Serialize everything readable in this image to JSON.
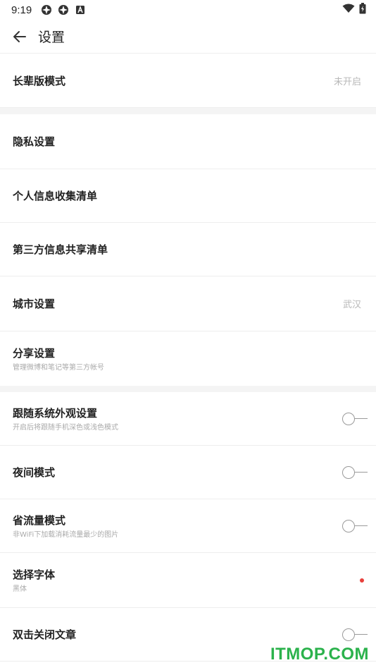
{
  "status_bar": {
    "time": "9:19",
    "battery_level": "charging"
  },
  "header": {
    "title": "设置"
  },
  "sections": {
    "elder": {
      "label": "长辈版模式",
      "value": "未开启"
    },
    "privacy": {
      "label": "隐私设置"
    },
    "personal_info": {
      "label": "个人信息收集清单"
    },
    "third_party": {
      "label": "第三方信息共享清单"
    },
    "city": {
      "label": "城市设置",
      "value": "武汉"
    },
    "share": {
      "label": "分享设置",
      "sub": "管理微博和笔记等第三方帐号"
    },
    "follow_system": {
      "label": "跟随系统外观设置",
      "sub": "开启后将跟随手机深色或浅色模式",
      "enabled": false
    },
    "night_mode": {
      "label": "夜间模式",
      "enabled": false
    },
    "data_saver": {
      "label": "省流量模式",
      "sub": "非WiFi下加载消耗流量最少的图片",
      "enabled": false
    },
    "font": {
      "label": "选择字体",
      "sub": "黑体"
    },
    "double_tap_close": {
      "label": "双击关闭文章",
      "enabled": false
    }
  },
  "watermark": "ITMOP.COM",
  "colors": {
    "accent_red": "#e8403c",
    "watermark_green": "#2bb24c"
  }
}
